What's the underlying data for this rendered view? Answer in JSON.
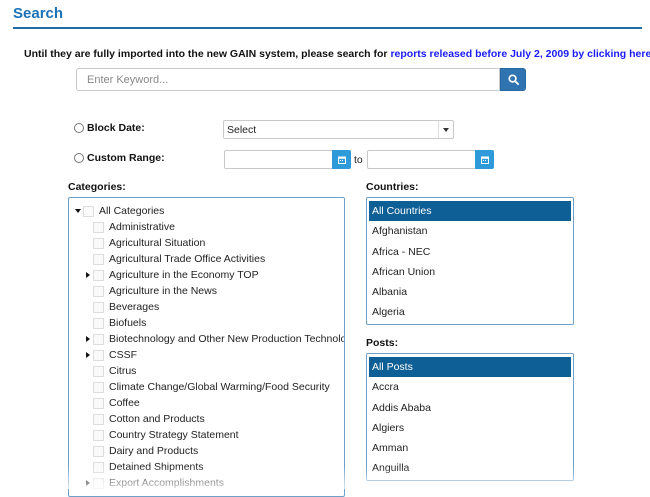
{
  "header": {
    "title": "Search"
  },
  "notice": {
    "prefix": "Until they are fully imported into the new GAIN system, please search for",
    "link": "reports released before July 2, 2009 by clicking here."
  },
  "search": {
    "placeholder": "Enter Keyword...",
    "button_icon": "search-icon"
  },
  "date_filter": {
    "block_date_label": "Block Date:",
    "select_value": "Select",
    "custom_range_label": "Custom Range:",
    "to_label": "to",
    "calendar_icon": "calendar-icon"
  },
  "categories": {
    "label": "Categories:",
    "items": [
      {
        "label": "All Categories",
        "toggle": "expanded"
      },
      {
        "label": "Administrative",
        "toggle": "none"
      },
      {
        "label": "Agricultural Situation",
        "toggle": "none"
      },
      {
        "label": "Agricultural Trade Office Activities",
        "toggle": "none"
      },
      {
        "label": "Agriculture in the Economy TOP",
        "toggle": "collapsed"
      },
      {
        "label": "Agriculture in the News",
        "toggle": "none"
      },
      {
        "label": "Beverages",
        "toggle": "none"
      },
      {
        "label": "Biofuels",
        "toggle": "none"
      },
      {
        "label": "Biotechnology and Other New Production Technologies",
        "toggle": "collapsed"
      },
      {
        "label": "CSSF",
        "toggle": "collapsed"
      },
      {
        "label": "Citrus",
        "toggle": "none"
      },
      {
        "label": "Climate Change/Global Warming/Food Security",
        "toggle": "none"
      },
      {
        "label": "Coffee",
        "toggle": "none"
      },
      {
        "label": "Cotton and Products",
        "toggle": "none"
      },
      {
        "label": "Country Strategy Statement",
        "toggle": "none"
      },
      {
        "label": "Dairy and Products",
        "toggle": "none"
      },
      {
        "label": "Detained Shipments",
        "toggle": "none"
      },
      {
        "label": "Export Accomplishments",
        "toggle": "collapsed"
      }
    ]
  },
  "countries": {
    "label": "Countries:",
    "items": [
      "All Countries",
      "Afghanistan",
      "Africa - NEC",
      "African Union",
      "Albania",
      "Algeria"
    ],
    "selected": "All Countries"
  },
  "posts": {
    "label": "Posts:",
    "items": [
      "All Posts",
      "Accra",
      "Addis Ababa",
      "Algiers",
      "Amman",
      "Anguilla"
    ],
    "selected": "All Posts"
  },
  "colors": {
    "title": "#1a73b7",
    "link": "#1a1aff",
    "search_button": "#2f74b1",
    "calendar_button": "#2f9ad9",
    "selected_item": "#0f5f97",
    "box_border": "#6fa0c8"
  }
}
